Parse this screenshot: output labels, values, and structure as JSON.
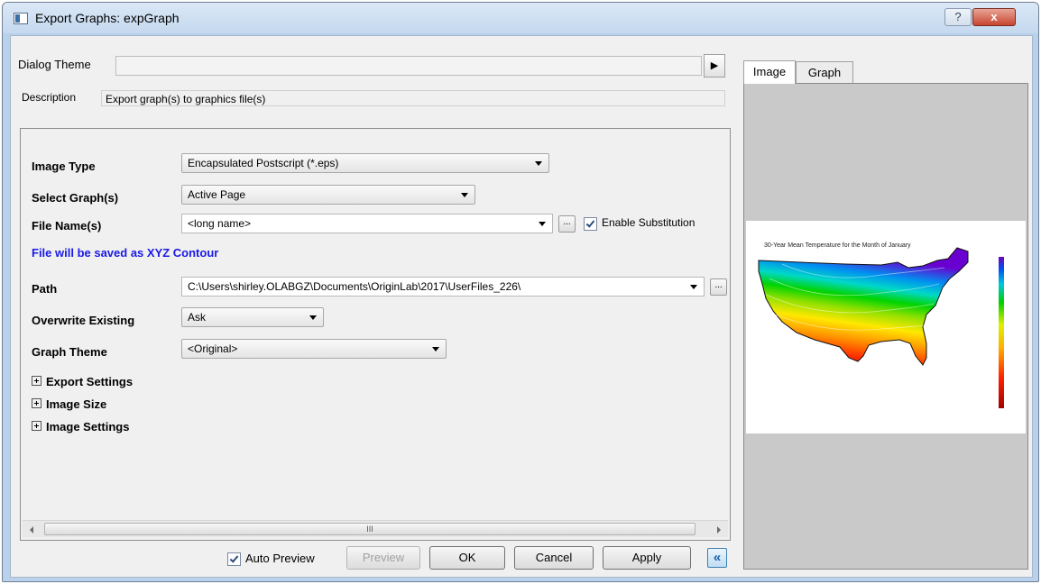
{
  "window": {
    "title": "Export Graphs: expGraph",
    "help_label": "?",
    "close_label": "x"
  },
  "dialog_theme": {
    "label": "Dialog Theme",
    "value": "",
    "arrow_glyph": "▶"
  },
  "description": {
    "label": "Description",
    "value": "Export graph(s) to graphics file(s)"
  },
  "form": {
    "image_type": {
      "label": "Image Type",
      "value": "Encapsulated Postscript (*.eps)"
    },
    "select_graphs": {
      "label": "Select Graph(s)",
      "value": "Active Page"
    },
    "file_names": {
      "label": "File Name(s)",
      "value": "<long name>",
      "browse": "...",
      "substitution_label": "Enable Substitution",
      "substitution_checked": true
    },
    "save_note": "File will be saved as XYZ Contour",
    "path": {
      "label": "Path",
      "value": "C:\\Users\\shirley.OLABGZ\\Documents\\OriginLab\\2017\\UserFiles_226\\",
      "browse": "..."
    },
    "overwrite": {
      "label": "Overwrite Existing",
      "value": "Ask"
    },
    "graph_theme": {
      "label": "Graph Theme",
      "value": "<Original>"
    },
    "sections": [
      "Export Settings",
      "Image Size",
      "Image Settings"
    ],
    "scroll_thumb_glyph": "III"
  },
  "buttons": {
    "auto_preview_label": "Auto Preview",
    "auto_preview_checked": true,
    "preview": "Preview",
    "ok": "OK",
    "cancel": "Cancel",
    "apply": "Apply",
    "collapse": "«"
  },
  "preview_panel": {
    "tabs": [
      "Image",
      "Graph"
    ],
    "active_tab": "Image",
    "chart_title": "30-Year Mean Temperature for the Month of January"
  },
  "colors": {
    "accent_blue": "#1a1ae6",
    "title_bar": "#c4d8ee",
    "close_red": "#c8452f"
  }
}
